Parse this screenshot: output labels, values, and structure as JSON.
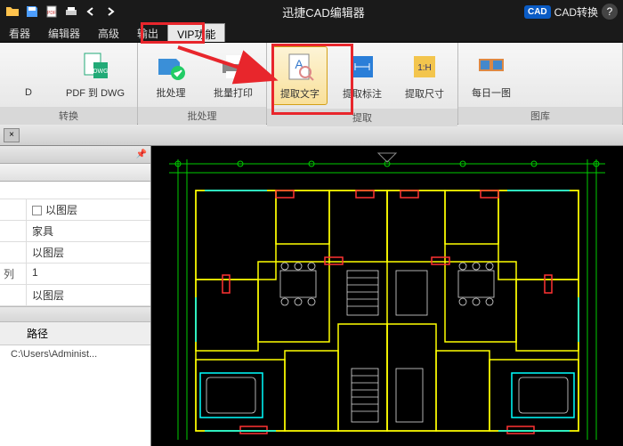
{
  "title": "迅捷CAD编辑器",
  "cad_convert": "CAD转换",
  "menu": {
    "items": [
      "看器",
      "编辑器",
      "高级",
      "输出",
      "VIP功能"
    ]
  },
  "ribbon": {
    "groups": [
      {
        "label": "转换",
        "buttons": [
          {
            "label": "D"
          },
          {
            "label": "PDF 到 DWG"
          }
        ]
      },
      {
        "label": "批处理",
        "buttons": [
          {
            "label": "批处理"
          },
          {
            "label": "批量打印"
          }
        ]
      },
      {
        "label": "提取",
        "buttons": [
          {
            "label": "提取文字"
          },
          {
            "label": "提取标注"
          },
          {
            "label": "提取尺寸"
          }
        ]
      },
      {
        "label": "图库",
        "buttons": [
          {
            "label": "每日一图"
          }
        ]
      }
    ]
  },
  "panel": {
    "rows": [
      {
        "a": "",
        "b": "以图层",
        "checkbox": true
      },
      {
        "a": "",
        "b": "家具"
      },
      {
        "a": "",
        "b": "以图层"
      },
      {
        "a": "列",
        "b": "1"
      },
      {
        "a": "",
        "b": "以图层"
      }
    ],
    "subheader": "路径",
    "path": "C:\\Users\\Administ..."
  }
}
